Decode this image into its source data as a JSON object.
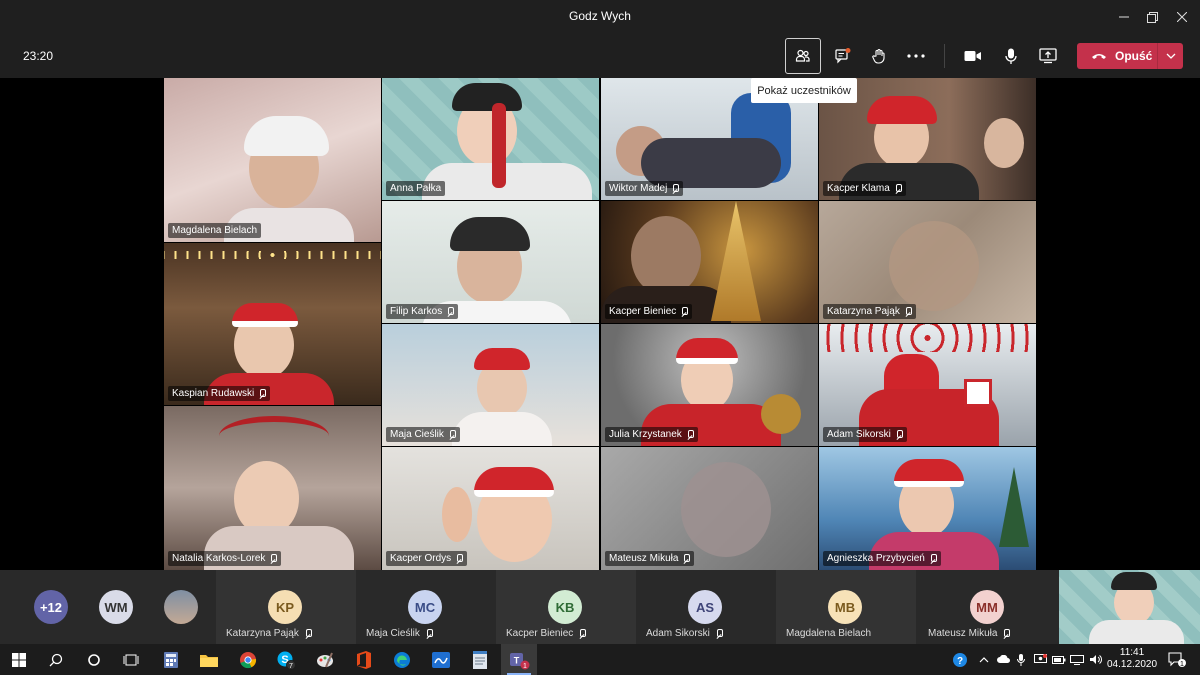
{
  "window": {
    "title": "Godz Wych"
  },
  "toolbar": {
    "timer": "23:20",
    "leave_label": "Opuść",
    "tooltip": "Pokaż uczestników"
  },
  "tiles": [
    {
      "name": "Magdalena Bielach"
    },
    {
      "name": "Anna Pałka"
    },
    {
      "name": "Wiktor Madej"
    },
    {
      "name": "Kacper Klama"
    },
    {
      "name": "Filip Karkos"
    },
    {
      "name": "Kacper Bieniec"
    },
    {
      "name": "Katarzyna Pająk"
    },
    {
      "name": "Kaspian Rudawski"
    },
    {
      "name": "Maja Cieślik"
    },
    {
      "name": "Julia Krzystanek"
    },
    {
      "name": "Adam Sikorski"
    },
    {
      "name": "Natalia Karkos-Lorek"
    },
    {
      "name": "Kacper Ordys"
    },
    {
      "name": "Mateusz Mikuła"
    },
    {
      "name": "Agnieszka Przybycień"
    }
  ],
  "roster": {
    "more": "+12",
    "wm": "WM",
    "people": [
      {
        "initials": "KP",
        "name": "Katarzyna Pająk",
        "color": "#f5deb3"
      },
      {
        "initials": "MC",
        "name": "Maja Cieślik",
        "color": "#c9d4f0"
      },
      {
        "initials": "KB",
        "name": "Kacper Bieniec",
        "color": "#d2ecd3"
      },
      {
        "initials": "AS",
        "name": "Adam Sikorski",
        "color": "#d6d9ee"
      },
      {
        "initials": "MB",
        "name": "Magdalena Bielach",
        "color": "#f7e2b8"
      },
      {
        "initials": "MM",
        "name": "Mateusz Mikuła",
        "color": "#f2d1cf"
      }
    ]
  },
  "taskbar": {
    "time": "11:41",
    "date": "04.12.2020",
    "skype_badge": "7",
    "teams_badge": "1",
    "notif_count": "1"
  },
  "colors": {
    "leave": "#c4314b",
    "accent": "#6264a7"
  }
}
